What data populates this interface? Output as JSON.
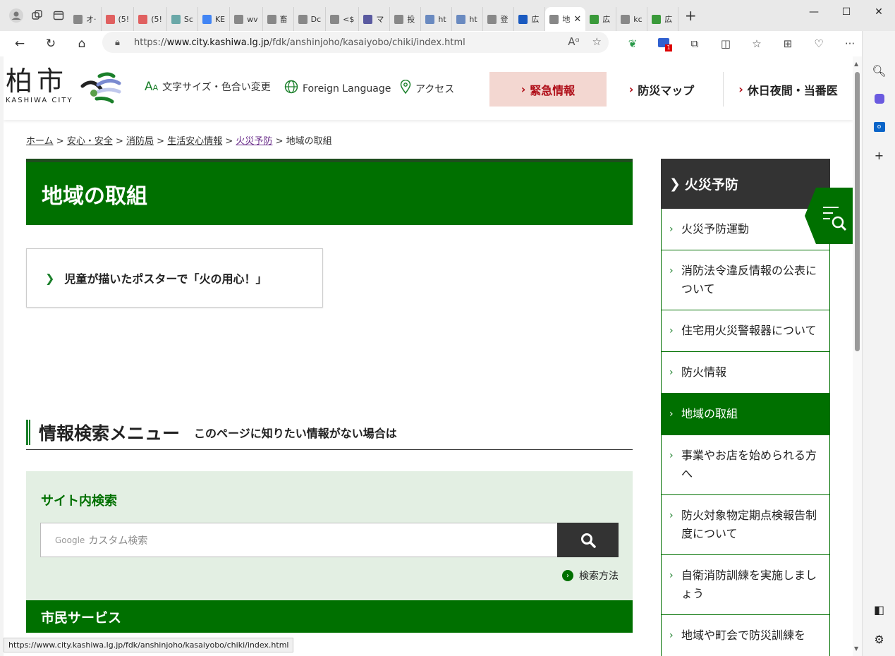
{
  "browser": {
    "tabs": [
      {
        "label": "オ·",
        "icon": "page-icon",
        "color": "#888888"
      },
      {
        "label": "(5!",
        "icon": "youtube-icon",
        "color": "#e06060"
      },
      {
        "label": "(5!",
        "icon": "youtube-icon",
        "color": "#e06060"
      },
      {
        "label": "Sc",
        "icon": "app-icon",
        "color": "#6aa8a8"
      },
      {
        "label": "KE",
        "icon": "google-icon",
        "color": "#4285f4"
      },
      {
        "label": "wv",
        "icon": "page-icon",
        "color": "#888888"
      },
      {
        "label": "畜",
        "icon": "page-icon",
        "color": "#888888"
      },
      {
        "label": "Dc",
        "icon": "page-icon",
        "color": "#888888"
      },
      {
        "label": "<$",
        "icon": "page-icon",
        "color": "#888888"
      },
      {
        "label": "マ",
        "icon": "translate-icon",
        "color": "#5a5aa0"
      },
      {
        "label": "投",
        "icon": "page-icon",
        "color": "#888888"
      },
      {
        "label": "ht",
        "icon": "search-icon",
        "color": "#6a8ac0"
      },
      {
        "label": "ht",
        "icon": "search-icon",
        "color": "#6a8ac0"
      },
      {
        "label": "登",
        "icon": "page-icon",
        "color": "#888888"
      },
      {
        "label": "広",
        "icon": "search-icon",
        "color": "#1a5ac0"
      },
      {
        "label": "地",
        "icon": "site-icon",
        "color": "#888888",
        "active": true
      },
      {
        "label": "広",
        "icon": "kashiwa-icon",
        "color": "#3a9a3a"
      },
      {
        "label": "kc",
        "icon": "page-icon",
        "color": "#888888"
      },
      {
        "label": "広",
        "icon": "kashiwa-icon",
        "color": "#3a9a3a"
      }
    ],
    "url_prefix": "https://",
    "url_host": "www.city.kashiwa.lg.jp",
    "url_path": "/fdk/anshinjoho/kasaiyobo/chiki/index.html",
    "status_url": "https://www.city.kashiwa.lg.jp/fdk/anshinjoho/kasaiyobo/chiki/index.html",
    "ext_badge": "1"
  },
  "site": {
    "logo_kanji": "柏市",
    "logo_roman": "KASHIWA CITY",
    "header_links": {
      "font_size": "文字サイズ・色合い変更",
      "language": "Foreign Language",
      "access": "アクセス"
    },
    "header_buttons": {
      "emergency": "緊急情報",
      "map": "防災マップ",
      "night": "休日夜間・当番医"
    }
  },
  "breadcrumb": {
    "home": "ホーム",
    "sep": ">",
    "safety": "安心・安全",
    "fire_dept": "消防局",
    "life_info": "生活安心情報",
    "fire_prevention": "火災予防",
    "current": "地域の取組"
  },
  "page": {
    "title": "地域の取組",
    "card_link": "児童が描いたポスターで「火の用心！」"
  },
  "info_menu": {
    "title": "情報検索メニュー",
    "subtitle": "このページに知りたい情報がない場合は",
    "search_title": "サイト内検索",
    "search_brand": "Google",
    "search_placeholder": "カスタム検索",
    "search_help": "検索方法",
    "services_title": "市民サービス"
  },
  "sidenav": {
    "heading": "火災予防",
    "items": [
      {
        "label": "火災予防運動"
      },
      {
        "label": "消防法令違反情報の公表について"
      },
      {
        "label": "住宅用火災警報器について"
      },
      {
        "label": "防火情報"
      },
      {
        "label": "地域の取組",
        "active": true
      },
      {
        "label": "事業やお店を始められる方へ"
      },
      {
        "label": "防火対象物定期点検報告制度について"
      },
      {
        "label": "自衛消防訓練を実施しましょう"
      },
      {
        "label": "地域や町会で防災訓練を"
      }
    ]
  },
  "colors": {
    "brand_green": "#007000",
    "emergency_bg": "#f3d7d1",
    "emergency_text": "#b0101a"
  }
}
